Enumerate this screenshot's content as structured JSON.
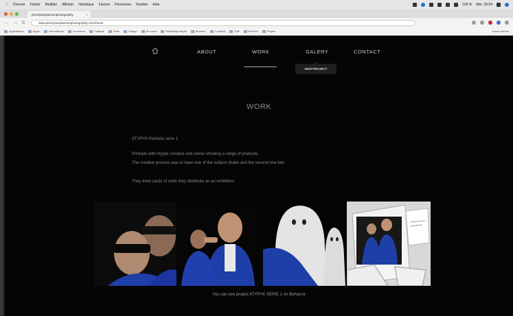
{
  "menubar": {
    "app": "Chrome",
    "items": [
      "Fichier",
      "Modifier",
      "Afficher",
      "Historique",
      "Favoris",
      "Personnes",
      "Fenêtre",
      "Aide"
    ],
    "battery": "100 %",
    "clock": "Mer. 20:54"
  },
  "browser": {
    "tab_title": "pierrejeanplansonphotography",
    "tab_close": "×",
    "url": "www.pierrejeanplansonphotography.com/#work",
    "nav_back": "←",
    "nav_forward": "→",
    "nav_reload": "C",
    "bookmarks": [
      "Applications",
      "Apple",
      "Informations",
      "Fourniture",
      "Pratique",
      "Work",
      "Design",
      "En cours",
      "Marketing simple",
      "Bureaux",
      "Contacts",
      "Soft",
      "Rentrée",
      "Projets"
    ],
    "other_bookmarks": "Autres favoris"
  },
  "site": {
    "nav": {
      "about": "ABOUT",
      "work": "WORK",
      "galery": "GALERY",
      "contact": "CONTACT"
    },
    "dropdown_item": "NEW PROJECT",
    "section_title": "WORK",
    "paragraphs": [
      "ATYPYK Portraits serie 1",
      "Portraits with Atypyk creative and owner showing a range of products.",
      "The creative process was to have one of the subject shake and the second one blur.",
      "They drew cards of visits they distribute on an exhibition."
    ],
    "caption": "You can see project ATYPYK SERIE 1 on Behance"
  },
  "colors": {
    "site_bg": "#050505",
    "nav_text": "#c9c9c9",
    "body_text": "#8a8a8a",
    "jacket_blue": "#1f3fa8"
  }
}
